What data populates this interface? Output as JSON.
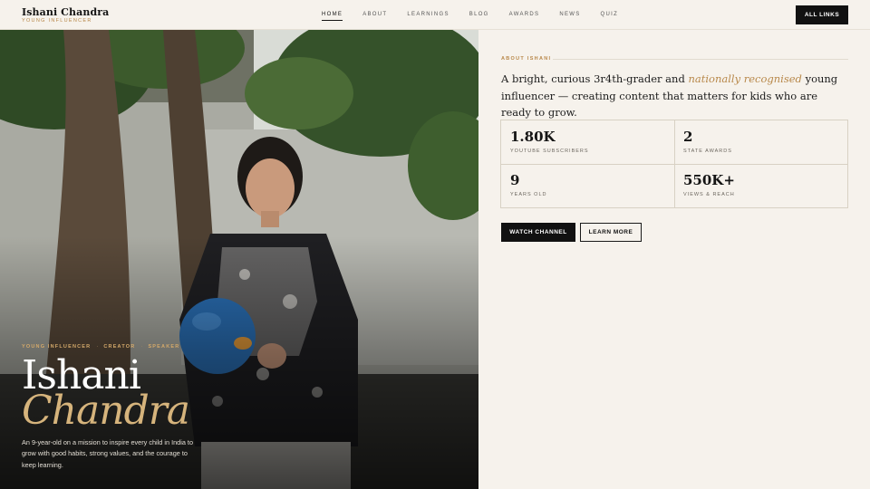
{
  "brand": {
    "name": "Ishani Chandra",
    "subtitle": "YOUNG INFLUENCER"
  },
  "nav": {
    "items": [
      {
        "label": "HOME",
        "active": true
      },
      {
        "label": "ABOUT",
        "active": false
      },
      {
        "label": "LEARNINGS",
        "active": false
      },
      {
        "label": "BLOG",
        "active": false
      },
      {
        "label": "AWARDS",
        "active": false
      },
      {
        "label": "NEWS",
        "active": false
      },
      {
        "label": "QUIZ",
        "active": false
      }
    ],
    "cta_label": "ALL LINKS"
  },
  "hero": {
    "tags": [
      "YOUNG INFLUENCER",
      "CREATOR",
      "SPEAKER"
    ],
    "first_name": "Ishani",
    "last_name": "Chandra",
    "description": "An 9-year-old on a mission to inspire every child in India to grow with good habits, strong values, and the courage to keep learning."
  },
  "about": {
    "label": "ABOUT ISHANI",
    "text_before": "A bright, curious 3r4th-grader and ",
    "text_highlight": "nationally recognised",
    "text_after": " young influencer — creating content that matters for kids who are ready to grow."
  },
  "stats": [
    {
      "value": "1.80K",
      "label": "YOUTUBE SUBSCRIBERS"
    },
    {
      "value": "2",
      "label": "STATE AWARDS"
    },
    {
      "value": "9",
      "label": "YEARS OLD"
    },
    {
      "value": "550K+",
      "label": "VIEWS & REACH"
    }
  ],
  "actions": {
    "watch_label": "WATCH CHANNEL",
    "learn_label": "LEARN MORE"
  },
  "colors": {
    "accent": "#b8884a",
    "background": "#f6f2ec",
    "dark": "#111111"
  }
}
